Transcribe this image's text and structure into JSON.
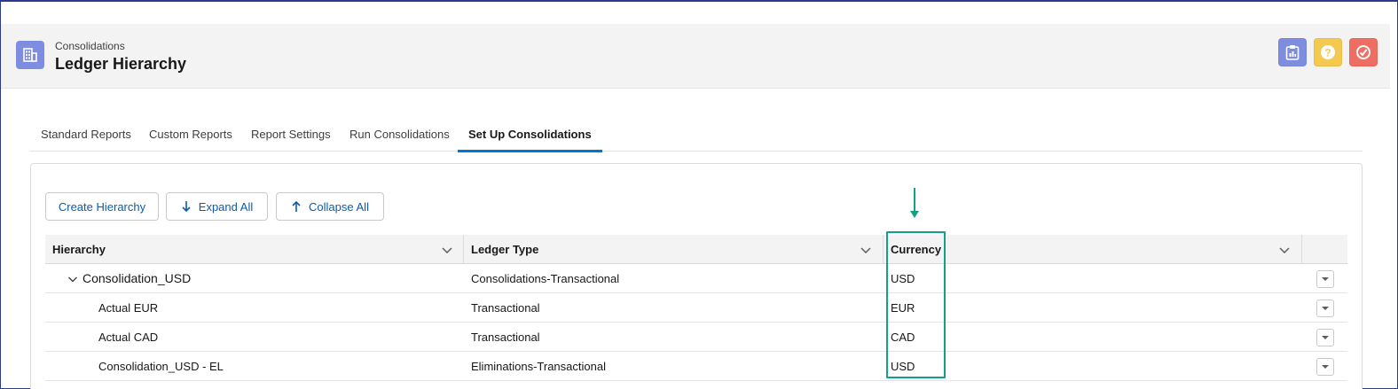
{
  "header": {
    "subtitle": "Consolidations",
    "title": "Ledger Hierarchy",
    "app_icon": "grid-building-icon",
    "actions": [
      {
        "icon": "clipboard-icon",
        "color": "#7f8de1"
      },
      {
        "icon": "help-icon",
        "color": "#f4c94f"
      },
      {
        "icon": "gauge-icon",
        "color": "#ef6e64"
      }
    ]
  },
  "tabs": [
    {
      "label": "Standard Reports",
      "active": false
    },
    {
      "label": "Custom Reports",
      "active": false
    },
    {
      "label": "Report Settings",
      "active": false
    },
    {
      "label": "Run Consolidations",
      "active": false
    },
    {
      "label": "Set Up Consolidations",
      "active": true
    }
  ],
  "toolbar": {
    "create_label": "Create Hierarchy",
    "expand_label": "Expand All",
    "collapse_label": "Collapse All"
  },
  "table": {
    "columns": [
      "Hierarchy",
      "Ledger Type",
      "Currency"
    ],
    "rows": [
      {
        "hierarchy": "Consolidation_USD",
        "ledger_type": "Consolidations-Transactional",
        "currency": "USD",
        "level": 0,
        "expanded": true
      },
      {
        "hierarchy": "Actual EUR",
        "ledger_type": "Transactional",
        "currency": "EUR",
        "level": 1
      },
      {
        "hierarchy": "Actual CAD",
        "ledger_type": "Transactional",
        "currency": "CAD",
        "level": 1
      },
      {
        "hierarchy": "Consolidation_USD - EL",
        "ledger_type": "Eliminations-Transactional",
        "currency": "USD",
        "level": 1
      }
    ]
  },
  "colors": {
    "accent": "#0176d3",
    "annotation": "#12a086",
    "link": "#0b5cab"
  }
}
